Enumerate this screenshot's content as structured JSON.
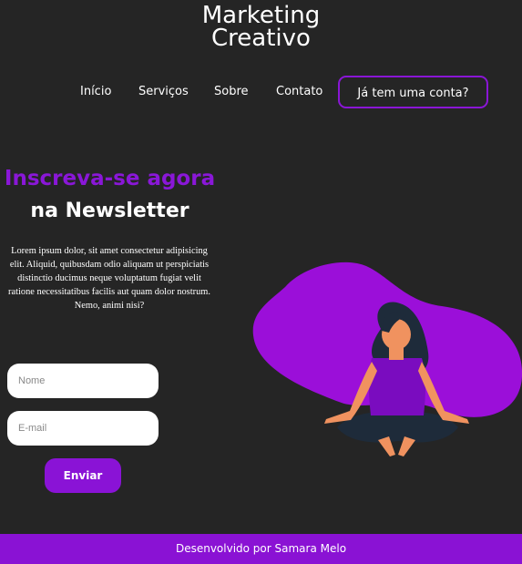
{
  "header": {
    "brand_line1": "Marketing",
    "brand_line2": "Creativo"
  },
  "nav": {
    "items": [
      {
        "label": "Início"
      },
      {
        "label": "Serviços"
      },
      {
        "label": "Sobre"
      },
      {
        "label": "Contato"
      }
    ],
    "account_button": "Já tem uma conta?"
  },
  "hero": {
    "title_line1": "Inscreva-se agora",
    "title_line2": "na Newsletter",
    "description": "Lorem ipsum dolor, sit amet consectetur adipisicing elit. Aliquid, quibusdam odio aliquam ut perspiciatis distinctio ducimus neque voluptatum fugiat velit ratione necessitatibus facilis aut quam dolor nostrum. Nemo, animi nisi?"
  },
  "form": {
    "name_placeholder": "Nome",
    "email_placeholder": "E-mail",
    "submit_label": "Enviar"
  },
  "footer": {
    "text": "Desenvolvido por Samara Melo"
  },
  "colors": {
    "background": "#252525",
    "accent": "#8a12d4",
    "blob": "#9b0fd9"
  }
}
